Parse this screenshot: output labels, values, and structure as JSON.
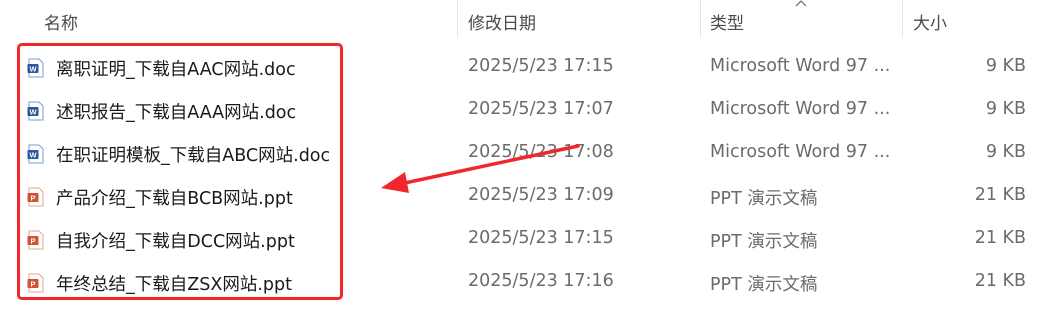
{
  "header": {
    "name_label": "名称",
    "date_label": "修改日期",
    "type_label": "类型",
    "size_label": "大小"
  },
  "files": [
    {
      "name": "离职证明_下载自AAC网站.doc",
      "date": "2025/5/23 17:15",
      "type": "Microsoft Word 97 ...",
      "size": "9 KB",
      "icon": "word-doc-icon"
    },
    {
      "name": "述职报告_下载自AAA网站.doc",
      "date": "2025/5/23 17:07",
      "type": "Microsoft Word 97 ...",
      "size": "9 KB",
      "icon": "word-doc-icon"
    },
    {
      "name": "在职证明模板_下载自ABC网站.doc",
      "date": "2025/5/23 17:08",
      "type": "Microsoft Word 97 ...",
      "size": "9 KB",
      "icon": "word-doc-icon"
    },
    {
      "name": "产品介绍_下载自BCB网站.ppt",
      "date": "2025/5/23 17:09",
      "type": "PPT 演示文稿",
      "size": "21 KB",
      "icon": "ppt-icon"
    },
    {
      "name": "自我介绍_下载自DCC网站.ppt",
      "date": "2025/5/23 17:15",
      "type": "PPT 演示文稿",
      "size": "21 KB",
      "icon": "ppt-icon"
    },
    {
      "name": "年终总结_下载自ZSX网站.ppt",
      "date": "2025/5/23 17:16",
      "type": "PPT 演示文稿",
      "size": "21 KB",
      "icon": "ppt-icon"
    }
  ],
  "colors": {
    "annotation": "#f2272c",
    "word_blue": "#2b579a",
    "ppt_orange": "#d35230"
  }
}
